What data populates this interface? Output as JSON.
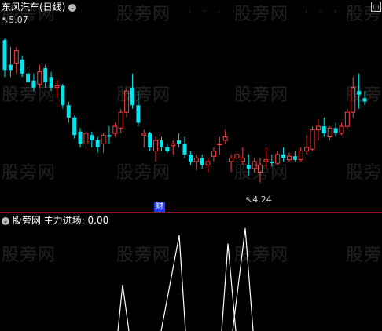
{
  "top_panel": {
    "title": "东风汽车(日线)",
    "high_label": "5.07",
    "low_label": "4.24",
    "badge": "财",
    "colors": {
      "up": "#ff4040",
      "down": "#00e5ee",
      "marker": "#c000c0",
      "badge_bg": "#1a3cff"
    }
  },
  "bottom_panel": {
    "title": "股旁网",
    "indicator_label": "主力进场: 0.00"
  },
  "watermark": "股旁网",
  "dots_left": "· · · ·",
  "dots_right": "· · · ·",
  "corner_icon": "panel-toggle-icon",
  "chart_data": [
    {
      "type": "candlestick",
      "title": "东风汽车(日线)",
      "ylim": [
        4.05,
        5.12
      ],
      "high_label": 5.07,
      "low_label": 4.24,
      "candles": [
        [
          4.99,
          5.0,
          4.78,
          4.82
        ],
        [
          4.85,
          4.95,
          4.78,
          4.82
        ],
        [
          4.86,
          4.95,
          4.8,
          4.93
        ],
        [
          4.88,
          4.9,
          4.78,
          4.8
        ],
        [
          4.8,
          4.84,
          4.73,
          4.75
        ],
        [
          4.76,
          4.8,
          4.7,
          4.72
        ],
        [
          4.74,
          4.85,
          4.72,
          4.81
        ],
        [
          4.83,
          4.85,
          4.72,
          4.75
        ],
        [
          4.78,
          4.81,
          4.7,
          4.72
        ],
        [
          4.72,
          4.76,
          4.66,
          4.73
        ],
        [
          4.73,
          4.74,
          4.6,
          4.62
        ],
        [
          4.62,
          4.64,
          4.52,
          4.55
        ],
        [
          4.55,
          4.56,
          4.43,
          4.45
        ],
        [
          4.47,
          4.49,
          4.38,
          4.4
        ],
        [
          4.4,
          4.48,
          4.37,
          4.46
        ],
        [
          4.45,
          4.47,
          4.38,
          4.42
        ],
        [
          4.42,
          4.44,
          4.35,
          4.38
        ],
        [
          4.4,
          4.46,
          4.35,
          4.45
        ],
        [
          4.45,
          4.5,
          4.4,
          4.44
        ],
        [
          4.46,
          4.52,
          4.44,
          4.5
        ],
        [
          4.49,
          4.6,
          4.46,
          4.58
        ],
        [
          4.58,
          4.72,
          4.55,
          4.7
        ],
        [
          4.72,
          4.8,
          4.6,
          4.62
        ],
        [
          4.62,
          4.7,
          4.5,
          4.52
        ],
        [
          4.45,
          4.48,
          4.38,
          4.46
        ],
        [
          4.46,
          4.47,
          4.36,
          4.38
        ],
        [
          4.36,
          4.44,
          4.3,
          4.42
        ],
        [
          4.42,
          4.44,
          4.36,
          4.38
        ],
        [
          4.38,
          4.4,
          4.35,
          4.36
        ],
        [
          4.39,
          4.42,
          4.34,
          4.4
        ],
        [
          4.42,
          4.46,
          4.38,
          4.4
        ],
        [
          4.4,
          4.44,
          4.32,
          4.34
        ],
        [
          4.34,
          4.36,
          4.28,
          4.3
        ],
        [
          4.3,
          4.34,
          4.25,
          4.32
        ],
        [
          4.32,
          4.34,
          4.26,
          4.28
        ],
        [
          4.28,
          4.32,
          4.24,
          4.3
        ],
        [
          4.33,
          4.38,
          4.3,
          4.36
        ],
        [
          4.4,
          4.44,
          4.34,
          4.4
        ],
        [
          4.42,
          4.48,
          4.4,
          4.44
        ],
        [
          4.3,
          4.34,
          4.24,
          4.32
        ],
        [
          4.32,
          4.36,
          4.26,
          4.34
        ],
        [
          4.3,
          4.38,
          4.28,
          4.32
        ],
        [
          4.28,
          4.34,
          4.22,
          4.26
        ],
        [
          4.26,
          4.32,
          4.24,
          4.3
        ],
        [
          4.24,
          4.32,
          4.18,
          4.28
        ],
        [
          4.3,
          4.38,
          4.26,
          4.31
        ],
        [
          4.3,
          4.34,
          4.27,
          4.29
        ],
        [
          4.29,
          4.36,
          4.28,
          4.34
        ],
        [
          4.34,
          4.38,
          4.3,
          4.32
        ],
        [
          4.31,
          4.35,
          4.3,
          4.33
        ],
        [
          4.33,
          4.36,
          4.3,
          4.31
        ],
        [
          4.31,
          4.38,
          4.3,
          4.36
        ],
        [
          4.36,
          4.45,
          4.34,
          4.38
        ],
        [
          4.37,
          4.5,
          4.36,
          4.48
        ],
        [
          4.48,
          4.54,
          4.42,
          4.5
        ],
        [
          4.5,
          4.55,
          4.44,
          4.46
        ],
        [
          4.44,
          4.5,
          4.42,
          4.49
        ],
        [
          4.49,
          4.52,
          4.44,
          4.46
        ],
        [
          4.46,
          4.52,
          4.45,
          4.5
        ],
        [
          4.5,
          4.6,
          4.48,
          4.58
        ],
        [
          4.58,
          4.78,
          4.55,
          4.72
        ],
        [
          4.7,
          4.8,
          4.6,
          4.68
        ],
        [
          4.66,
          4.7,
          4.62,
          4.64
        ]
      ]
    },
    {
      "type": "line",
      "title": "主力进场",
      "value": 0.0,
      "spikes": [
        0.45,
        0.93,
        0.85,
        1.0
      ]
    }
  ]
}
